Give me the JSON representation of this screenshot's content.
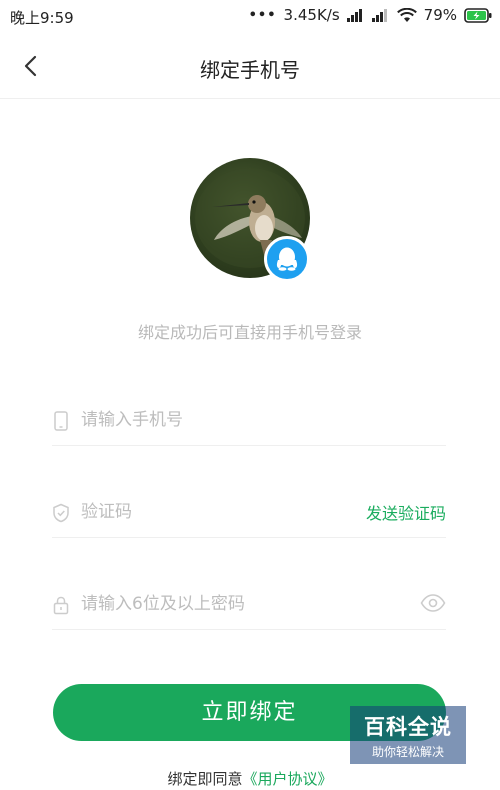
{
  "status_bar": {
    "time": "晚上9:59",
    "dots": "•••",
    "network_speed": "3.45K/s",
    "battery_percent": "79%"
  },
  "header": {
    "title": "绑定手机号"
  },
  "hint": "绑定成功后可直接用手机号登录",
  "form": {
    "phone_placeholder": "请输入手机号",
    "code_placeholder": "验证码",
    "send_code_label": "发送验证码",
    "password_placeholder": "请输入6位及以上密码"
  },
  "bind_button_label": "立即绑定",
  "agreement": {
    "prefix": "绑定即同意",
    "link": "《用户协议》"
  },
  "watermark": {
    "title": "百科全说",
    "subtitle": "助你轻松解决"
  },
  "colors": {
    "accent": "#1aa85c",
    "qq_badge": "#1ea0f0"
  }
}
